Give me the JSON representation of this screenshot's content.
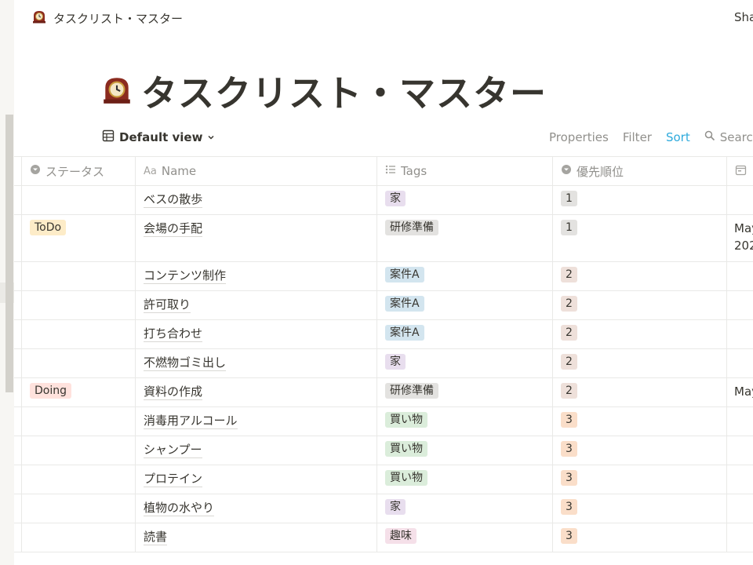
{
  "topbar": {
    "page_icon": "mantel-clock-icon",
    "breadcrumb": "タスクリスト・マスター",
    "share": "Sha"
  },
  "page": {
    "icon": "mantel-clock-icon",
    "title": "タスクリスト・マスター"
  },
  "view": {
    "icon": "table-icon",
    "name": "Default view",
    "actions": {
      "properties": "Properties",
      "filter": "Filter",
      "sort": "Sort",
      "search": "Search"
    }
  },
  "colors": {
    "accent_sort": "#2eaadc",
    "tag_purple": "#e8deee",
    "tag_gray": "#e3e2e0",
    "tag_blue": "#d3e5ef",
    "tag_green": "#dbeddb",
    "tag_pink": "#f5e0e9",
    "prio_gray": "#e3e2e0",
    "prio_brown": "#eee0da",
    "prio_orange": "#fadec9",
    "status_todo": "#fdecc8",
    "status_doing": "#ffe2dd"
  },
  "columns": [
    {
      "icon": "select-icon",
      "label": "ステータス"
    },
    {
      "icon": "text-icon",
      "label": "Name"
    },
    {
      "icon": "list-icon",
      "label": "Tags"
    },
    {
      "icon": "select-icon",
      "label": "優先順位"
    },
    {
      "icon": "calendar-icon",
      "label": ""
    }
  ],
  "rows": [
    {
      "status": "",
      "name": "ベスの散歩",
      "tag": "家",
      "tag_color": "#e8deee",
      "priority": "1",
      "prio_color": "#e3e2e0",
      "date": ""
    },
    {
      "status": "ToDo",
      "status_color": "#fdecc8",
      "name": "会場の手配",
      "tag": "研修準備",
      "tag_color": "#e3e2e0",
      "priority": "1",
      "prio_color": "#e3e2e0",
      "date": "May",
      "date2": "202"
    },
    {
      "status": "",
      "name": "コンテンツ制作",
      "tag": "案件A",
      "tag_color": "#d3e5ef",
      "priority": "2",
      "prio_color": "#eee0da",
      "date": ""
    },
    {
      "status": "",
      "name": "許可取り",
      "tag": "案件A",
      "tag_color": "#d3e5ef",
      "priority": "2",
      "prio_color": "#eee0da",
      "date": ""
    },
    {
      "status": "",
      "name": "打ち合わせ",
      "tag": "案件A",
      "tag_color": "#d3e5ef",
      "priority": "2",
      "prio_color": "#eee0da",
      "date": ""
    },
    {
      "status": "",
      "name": "不燃物ゴミ出し",
      "tag": "家",
      "tag_color": "#e8deee",
      "priority": "2",
      "prio_color": "#eee0da",
      "date": ""
    },
    {
      "status": "Doing",
      "status_color": "#ffe2dd",
      "name": "資料の作成",
      "tag": "研修準備",
      "tag_color": "#e3e2e0",
      "priority": "2",
      "prio_color": "#eee0da",
      "date": "May"
    },
    {
      "status": "",
      "name": "消毒用アルコール",
      "tag": "買い物",
      "tag_color": "#dbeddb",
      "priority": "3",
      "prio_color": "#fadec9",
      "date": ""
    },
    {
      "status": "",
      "name": "シャンプー",
      "tag": "買い物",
      "tag_color": "#dbeddb",
      "priority": "3",
      "prio_color": "#fadec9",
      "date": ""
    },
    {
      "status": "",
      "name": "プロテイン",
      "tag": "買い物",
      "tag_color": "#dbeddb",
      "priority": "3",
      "prio_color": "#fadec9",
      "date": ""
    },
    {
      "status": "",
      "name": "植物の水やり",
      "tag": "家",
      "tag_color": "#e8deee",
      "priority": "3",
      "prio_color": "#fadec9",
      "date": ""
    },
    {
      "status": "",
      "name": "読書",
      "tag": "趣味",
      "tag_color": "#f5e0e9",
      "priority": "3",
      "prio_color": "#fadec9",
      "date": ""
    }
  ]
}
